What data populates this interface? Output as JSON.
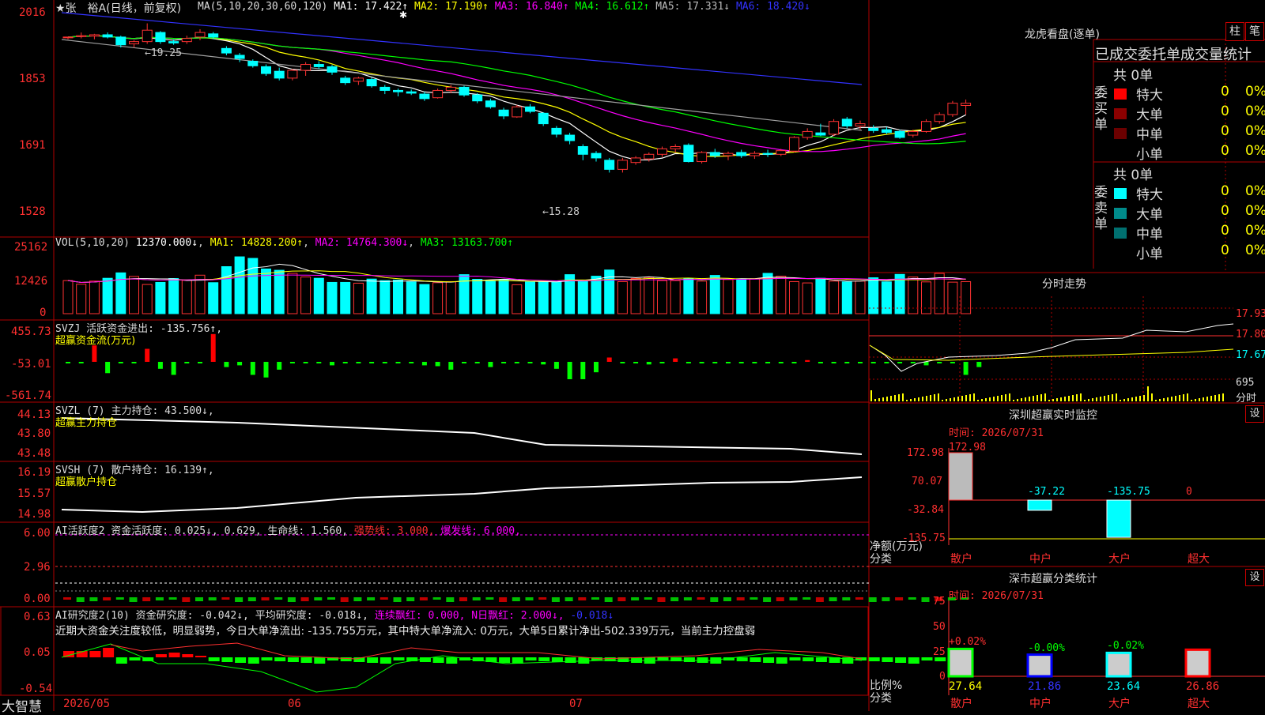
{
  "colors": {
    "up": "#ff3232",
    "down": "#00ffff",
    "ma1": "#ffffff",
    "ma2": "#ffff00",
    "ma3": "#ff00ff",
    "ma4": "#00ff00",
    "ma5": "#a0a0a0",
    "ma6": "#3232ff",
    "grid": "#b00000"
  },
  "header": {
    "title": "★张　裕A(日线，前复权)",
    "ma_params": "MA(5,10,20,30,60,120)",
    "ma1": "MA1: 17.422↑",
    "ma2": "MA2: 17.190↑",
    "ma3": "MA3: 16.840↑",
    "ma4": "MA4: 16.612↑",
    "ma5": "MA5: 17.331↓",
    "ma6": "MA6: 18.420↓"
  },
  "price_panel": {
    "ticks": [
      "2016",
      "1853",
      "1691",
      "1528"
    ],
    "high_label": "←19.25",
    "low_label": "←15.28"
  },
  "vol_panel": {
    "title": "VOL(5,10,20)",
    "value": "12370.000↓",
    "ma1": "MA1: 14828.200↑",
    "ma2": "MA2: 14764.300↓",
    "ma3": "MA3: 13163.700↑",
    "ticks": [
      "25162",
      "12426",
      "0"
    ]
  },
  "svzj_panel": {
    "title": "SVZJ  活跃资金进出: -135.756↑,",
    "subtitle": "超赢资金流(万元)",
    "ticks": [
      "455.73",
      "-53.01",
      "-561.74"
    ]
  },
  "svzl_panel": {
    "title": "SVZL (7) 主力持仓: 43.500↓,",
    "subtitle": "超赢主力持仓",
    "ticks": [
      "44.13",
      "43.80",
      "43.48"
    ]
  },
  "svsh_panel": {
    "title": "SVSH (7) 散户持仓: 16.139↑,",
    "subtitle": "超赢散户持仓",
    "ticks": [
      "16.19",
      "15.57",
      "14.98"
    ]
  },
  "ai2_panel": {
    "title": "AI活跃度2 资金活跃度: 0.025↓, 0.629, 生命线: 1.560,",
    "strong": "强势线: 3.000,",
    "burst": "爆发线: 6.000,",
    "ticks": [
      "6.00",
      "2.96",
      "0.00"
    ]
  },
  "ai_research": {
    "title": "AI研究度2(10) 资金研究度: -0.042↓, 平均研究度: -0.018↓,",
    "red1": "连续飘红: 0.000, N日飘红: 2.000↓,",
    "tail": "-0.018↓",
    "comment": "近期大资金关注度较低，明显弱势，今日大单净流出: -135.755万元，其中特大单净流入: 0万元，大单5日累计净出-502.339万元，当前主力控盘弱",
    "ticks": [
      "0.63",
      "0.05",
      "-0.54"
    ]
  },
  "footer": {
    "brand": "大智慧",
    "dates": [
      "2026/05",
      "06",
      "07"
    ]
  },
  "right": {
    "lhb_title": "龙虎看盘(逐单)",
    "btn1": "柱",
    "btn2": "笔",
    "stat_title": "已成交委托单成交量统计",
    "buy": {
      "side_label": "委买单",
      "total": "共 0单",
      "rows": [
        {
          "name": "特大",
          "v": "0",
          "p": "0%",
          "color": "#ff0000"
        },
        {
          "name": "大单",
          "v": "0",
          "p": "0%",
          "color": "#8b0000"
        },
        {
          "name": "中单",
          "v": "0",
          "p": "0%",
          "color": "#6b0000"
        },
        {
          "name": "小单",
          "v": "0",
          "p": "0%",
          "color": "#000000"
        }
      ]
    },
    "sell": {
      "side_label": "委卖单",
      "total": "共 0单",
      "rows": [
        {
          "name": "特大",
          "v": "0",
          "p": "0%",
          "color": "#00ffff"
        },
        {
          "name": "大单",
          "v": "0",
          "p": "0%",
          "color": "#008b8b"
        },
        {
          "name": "中单",
          "v": "0",
          "p": "0%",
          "color": "#007070"
        },
        {
          "name": "小单",
          "v": "0",
          "p": "0%",
          "color": "#000000"
        }
      ]
    },
    "intraday": {
      "title": "分时走势",
      "ticks": [
        "17.93",
        "17.80",
        "17.67"
      ],
      "vol_tick": "695",
      "vol_label": "分时"
    },
    "monitor": {
      "title": "深圳超赢实时监控",
      "set": "设",
      "time": "时间: 2026/07/31",
      "ticks": [
        "172.98",
        "70.07",
        "-32.84",
        "-135.75"
      ],
      "axis_label": "净额(万元)",
      "cat_label": "分类",
      "values": [
        {
          "cat": "散户",
          "val": "172.98",
          "num": 172.98
        },
        {
          "cat": "中户",
          "val": "-37.22",
          "num": -37.22
        },
        {
          "cat": "大户",
          "val": "-135.75",
          "num": -135.75
        },
        {
          "cat": "超大",
          "val": "0",
          "num": 0
        }
      ]
    },
    "classify": {
      "title": "深市超赢分类统计",
      "set": "设",
      "time": "时间: 2026/07/31",
      "ticks": [
        "75",
        "50",
        "25",
        "0"
      ],
      "axis_label": "比例%",
      "cat_label": "分类",
      "values": [
        {
          "cat": "散户",
          "top": "+0.02%",
          "val": "27.64",
          "num": 27.64,
          "color": "#00ff00"
        },
        {
          "cat": "中户",
          "top": "-0.00%",
          "val": "21.86",
          "num": 21.86,
          "color": "#0000ff"
        },
        {
          "cat": "大户",
          "top": "-0.02%",
          "val": "23.64",
          "num": 23.64,
          "color": "#00ffff"
        },
        {
          "cat": "超大",
          "top": "",
          "val": "26.86",
          "num": 26.86,
          "color": "#ff0000"
        }
      ]
    }
  },
  "chart_data": {
    "type": "candlestick",
    "title": "张裕A 日线 前复权",
    "ohlc": [
      [
        18.95,
        18.95,
        18.9,
        18.95
      ],
      [
        18.96,
        19.05,
        18.92,
        18.98
      ],
      [
        18.97,
        19.02,
        18.9,
        19.0
      ],
      [
        19.0,
        19.05,
        18.92,
        18.95
      ],
      [
        18.95,
        18.98,
        18.72,
        18.78
      ],
      [
        18.8,
        18.88,
        18.72,
        18.85
      ],
      [
        18.85,
        19.25,
        18.8,
        19.1
      ],
      [
        19.05,
        19.08,
        18.8,
        18.85
      ],
      [
        18.85,
        18.9,
        18.78,
        18.82
      ],
      [
        18.85,
        18.98,
        18.8,
        18.92
      ],
      [
        18.95,
        19.12,
        18.88,
        19.05
      ],
      [
        19.02,
        19.06,
        18.9,
        18.95
      ],
      [
        18.7,
        18.75,
        18.55,
        18.6
      ],
      [
        18.55,
        18.6,
        18.4,
        18.48
      ],
      [
        18.42,
        18.46,
        18.28,
        18.32
      ],
      [
        18.3,
        18.35,
        18.1,
        18.15
      ],
      [
        18.2,
        18.28,
        18.0,
        18.05
      ],
      [
        18.05,
        18.25,
        18.0,
        18.22
      ],
      [
        18.22,
        18.4,
        18.1,
        18.35
      ],
      [
        18.35,
        18.42,
        18.25,
        18.3
      ],
      [
        18.3,
        18.34,
        18.12,
        18.18
      ],
      [
        18.05,
        18.1,
        17.9,
        17.95
      ],
      [
        17.98,
        18.08,
        17.9,
        18.05
      ],
      [
        18.02,
        18.06,
        17.84,
        17.88
      ],
      [
        17.85,
        17.9,
        17.7,
        17.78
      ],
      [
        17.78,
        17.82,
        17.65,
        17.75
      ],
      [
        17.75,
        17.8,
        17.68,
        17.72
      ],
      [
        17.7,
        17.75,
        17.55,
        17.6
      ],
      [
        17.62,
        17.82,
        17.6,
        17.78
      ],
      [
        17.78,
        17.9,
        17.72,
        17.85
      ],
      [
        17.85,
        17.88,
        17.64,
        17.68
      ],
      [
        17.68,
        17.72,
        17.5,
        17.55
      ],
      [
        17.55,
        17.6,
        17.38,
        17.42
      ],
      [
        17.35,
        17.4,
        17.15,
        17.22
      ],
      [
        17.2,
        17.46,
        17.18,
        17.42
      ],
      [
        17.42,
        17.48,
        17.28,
        17.32
      ],
      [
        17.28,
        17.3,
        17.0,
        17.05
      ],
      [
        16.95,
        17.0,
        16.75,
        16.82
      ],
      [
        16.8,
        16.85,
        16.6,
        16.68
      ],
      [
        16.55,
        16.6,
        16.25,
        16.38
      ],
      [
        16.4,
        16.45,
        16.22,
        16.3
      ],
      [
        16.25,
        16.3,
        15.98,
        16.05
      ],
      [
        16.05,
        16.3,
        15.98,
        16.25
      ],
      [
        16.2,
        16.34,
        16.15,
        16.3
      ],
      [
        16.28,
        16.42,
        16.22,
        16.38
      ],
      [
        16.38,
        16.55,
        16.32,
        16.5
      ],
      [
        16.5,
        16.6,
        16.42,
        16.55
      ],
      [
        16.58,
        16.62,
        16.2,
        16.22
      ],
      [
        16.22,
        16.45,
        16.18,
        16.42
      ],
      [
        16.42,
        16.5,
        16.3,
        16.35
      ],
      [
        16.35,
        16.44,
        16.25,
        16.4
      ],
      [
        16.42,
        16.48,
        16.3,
        16.35
      ],
      [
        16.35,
        16.45,
        16.28,
        16.4
      ],
      [
        16.4,
        16.48,
        16.32,
        16.38
      ],
      [
        16.38,
        16.5,
        16.34,
        16.46
      ],
      [
        16.45,
        16.78,
        16.42,
        16.75
      ],
      [
        16.75,
        16.95,
        16.7,
        16.88
      ],
      [
        16.85,
        17.05,
        16.78,
        16.8
      ],
      [
        16.82,
        17.15,
        16.78,
        17.1
      ],
      [
        17.15,
        17.2,
        16.95,
        17.0
      ],
      [
        17.0,
        17.12,
        16.92,
        17.05
      ],
      [
        16.95,
        17.02,
        16.85,
        16.9
      ],
      [
        16.92,
        16.98,
        16.82,
        16.86
      ],
      [
        16.88,
        16.92,
        16.72,
        16.75
      ],
      [
        16.8,
        16.92,
        16.75,
        16.88
      ],
      [
        16.88,
        17.15,
        16.85,
        17.1
      ],
      [
        17.1,
        17.3,
        17.05,
        17.25
      ],
      [
        17.25,
        17.55,
        17.2,
        17.5
      ],
      [
        17.45,
        17.58,
        17.25,
        17.5
      ]
    ],
    "volume": [
      12800,
      11400,
      12600,
      13700,
      15800,
      14400,
      11300,
      12100,
      13600,
      12900,
      14900,
      12000,
      18200,
      22000,
      21400,
      17300,
      16800,
      15600,
      14200,
      13700,
      12100,
      12100,
      11800,
      13400,
      12800,
      13000,
      12300,
      11300,
      12000,
      12400,
      15100,
      13300,
      12800,
      13100,
      11200,
      12300,
      12600,
      12300,
      15100,
      12400,
      14500,
      16900,
      12400,
      13600,
      14000,
      12800,
      12800,
      13600,
      12600,
      14800,
      13200,
      13500,
      13500,
      15600,
      14500,
      12400,
      11900,
      13700,
      12600,
      12300,
      12600,
      13900,
      12300,
      15200,
      14200,
      12300,
      15600,
      12200,
      12400
    ],
    "svzj": [
      -5,
      -5,
      190,
      -130,
      -5,
      -5,
      150,
      -80,
      -150,
      -5,
      -5,
      320,
      -60,
      -40,
      -150,
      -180,
      -90,
      -5,
      -5,
      -5,
      -40,
      -5,
      -5,
      -5,
      -5,
      -5,
      -5,
      -40,
      -50,
      -90,
      -5,
      -5,
      -60,
      -10,
      -5,
      -10,
      -30,
      -80,
      -200,
      -200,
      -120,
      50,
      -5,
      -5,
      -30,
      -5,
      40,
      -5,
      -5,
      -5,
      -5,
      -5,
      -5,
      -5,
      -5,
      -5,
      20,
      -5,
      -5,
      -5,
      -5,
      -5,
      -5,
      -5,
      -5,
      -40,
      -5,
      -5,
      -150,
      -60
    ]
  }
}
